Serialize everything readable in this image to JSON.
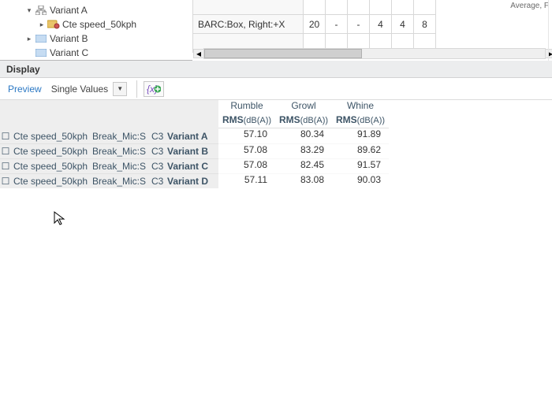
{
  "top_right_label": "Average, F",
  "tree": {
    "n0": {
      "label": "Variant A",
      "caret": "▾"
    },
    "n1": {
      "label": "Cte speed_50kph",
      "caret": "▸"
    },
    "n2": {
      "label": "Variant B",
      "caret": "▸"
    },
    "n3": {
      "label": "Variant C",
      "caret": ""
    }
  },
  "grid": {
    "r0": {
      "label": "BARC:Box, Right:+X",
      "c0": "20",
      "c1": "-",
      "c2": "-",
      "c3": "4",
      "c4": "4",
      "c5": "8"
    },
    "rTop": {
      "c0": "",
      "c1": "",
      "c2": "",
      "c3": "",
      "c4": "",
      "c5": ""
    }
  },
  "panel_title": "Display",
  "toolbar": {
    "preview": "Preview",
    "mode": "Single Values"
  },
  "headers": {
    "c0": "Rumble",
    "c1": "Growl",
    "c2": "Whine",
    "u0": "RMS",
    "u1": "RMS",
    "u2": "RMS",
    "unit": "(dB(A))"
  },
  "rows": {
    "r0": {
      "a": "Cte speed_50kph",
      "b": "Break_Mic:S",
      "c": "C3",
      "d": "Variant A",
      "v0": "57.10",
      "v1": "80.34",
      "v2": "91.89"
    },
    "r1": {
      "a": "Cte speed_50kph",
      "b": "Break_Mic:S",
      "c": "C3",
      "d": "Variant B",
      "v0": "57.08",
      "v1": "83.29",
      "v2": "89.62"
    },
    "r2": {
      "a": "Cte speed_50kph",
      "b": "Break_Mic:S",
      "c": "C3",
      "d": "Variant C",
      "v0": "57.08",
      "v1": "82.45",
      "v2": "91.57"
    },
    "r3": {
      "a": "Cte speed_50kph",
      "b": "Break_Mic:S",
      "c": "C3",
      "d": "Variant D",
      "v0": "57.11",
      "v1": "83.08",
      "v2": "90.03"
    }
  }
}
